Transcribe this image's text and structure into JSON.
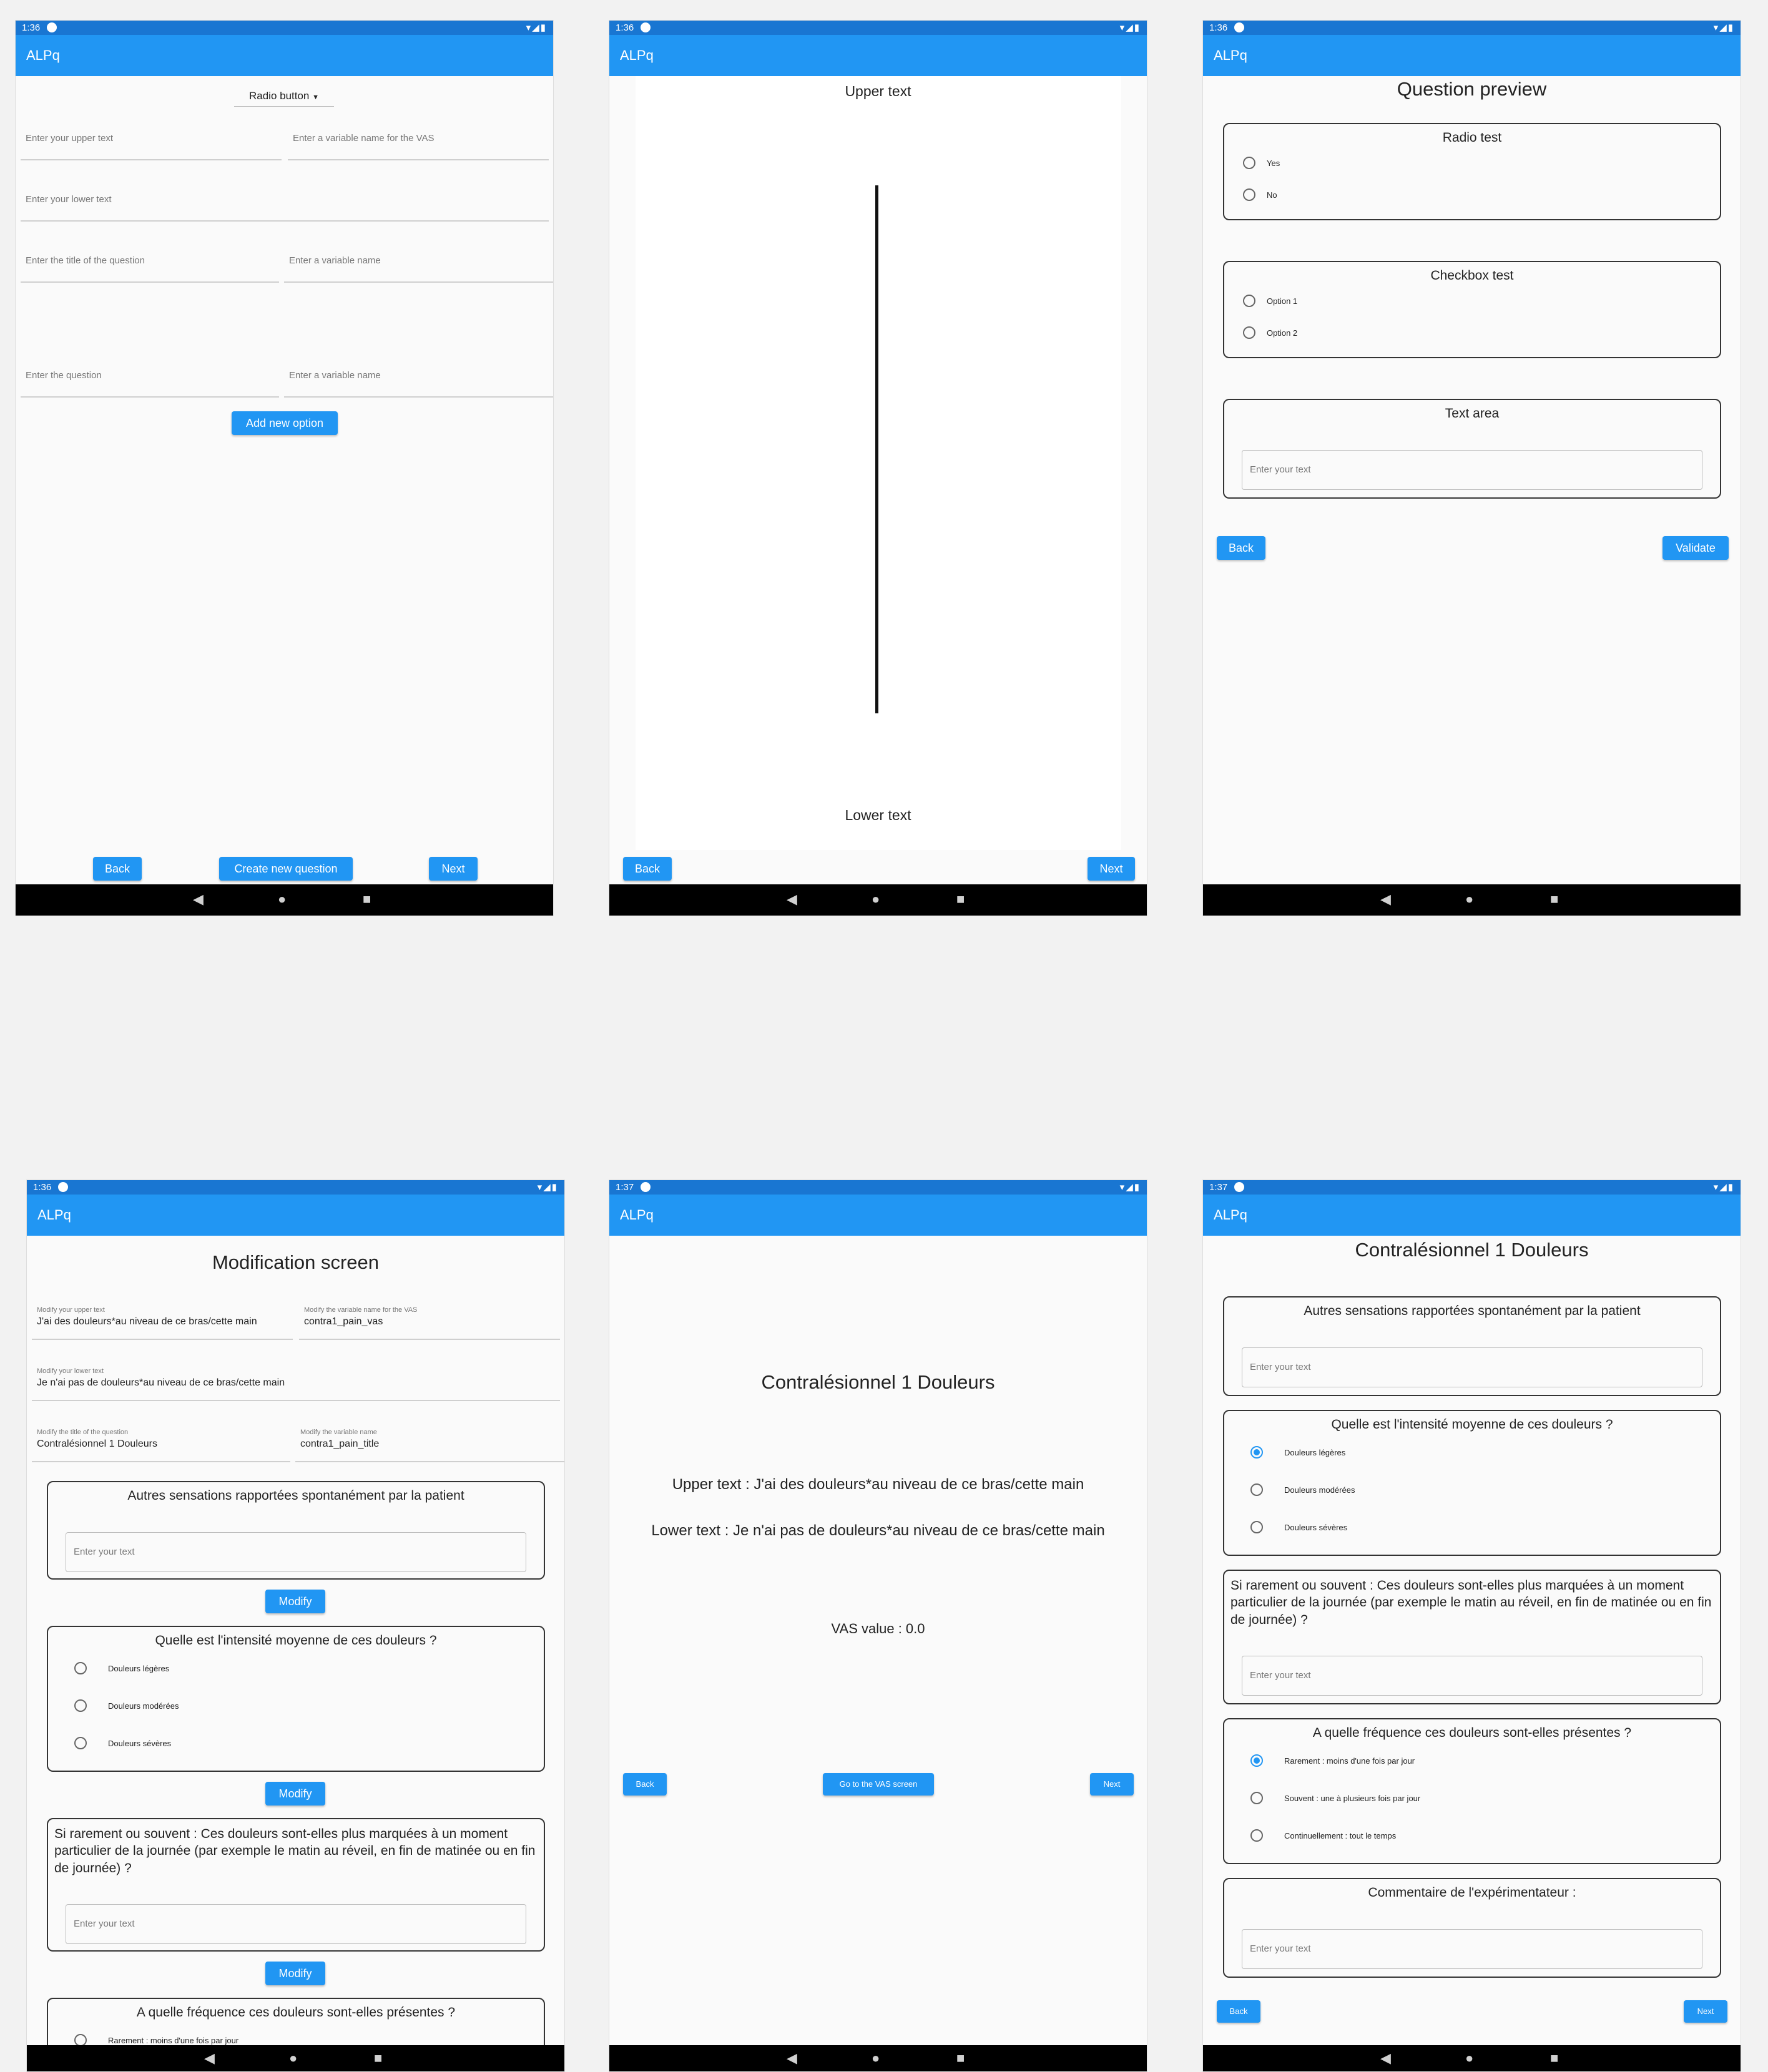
{
  "app_name": "ALPq",
  "status_icons": "▾◢▮",
  "nav": {
    "back": "◀",
    "home": "●",
    "recent": "■"
  },
  "s1": {
    "time": "1:36",
    "dropdown": "Radio button",
    "upper_ph": "Enter your upper text",
    "vas_var_ph": "Enter a variable name for the VAS",
    "lower_ph": "Enter your lower text",
    "title_ph": "Enter the title of the question",
    "var_ph": "Enter a variable name",
    "question_ph": "Enter the question",
    "var_ph2": "Enter a variable name",
    "add_option": "Add new option",
    "back": "Back",
    "create": "Create new question",
    "next": "Next"
  },
  "s2": {
    "time": "1:36",
    "upper": "Upper text",
    "lower": "Lower text",
    "back": "Back",
    "next": "Next"
  },
  "s3": {
    "time": "1:36",
    "title": "Question preview",
    "radio_title": "Radio test",
    "radio_opts": [
      "Yes",
      "No"
    ],
    "check_title": "Checkbox test",
    "check_opts": [
      "Option 1",
      "Option 2"
    ],
    "text_title": "Text area",
    "text_ph": "Enter your text",
    "back": "Back",
    "validate": "Validate"
  },
  "s4": {
    "time": "1:36",
    "title": "Modification screen",
    "f_upper_lbl": "Modify your upper text",
    "f_upper_val": "J'ai des douleurs*au niveau de ce bras/cette main",
    "f_vas_lbl": "Modify the variable name for the VAS",
    "f_vas_val": "contra1_pain_vas",
    "f_lower_lbl": "Modify your lower text",
    "f_lower_val": "Je n'ai pas de douleurs*au niveau de ce bras/cette main",
    "f_title_lbl": "Modify the title of the question",
    "f_title_val": "Contralésionnel 1 Douleurs",
    "f_var_lbl": "Modify the variable name",
    "f_var_val": "contra1_pain_title",
    "q1": "Autres sensations rapportées spontanément par la patient",
    "text_ph": "Enter your text",
    "modify": "Modify",
    "q2": "Quelle est l'intensité moyenne de ces douleurs ?",
    "q2_opts": [
      "Douleurs légères",
      "Douleurs modérées",
      "Douleurs sévères"
    ],
    "q3": "Si rarement ou souvent : Ces douleurs sont-elles plus marquées à un moment particulier de la journée (par exemple le matin au réveil, en fin de matinée ou en fin de journée) ?",
    "q4": "A quelle fréquence ces douleurs sont-elles présentes ?",
    "q4_first": "Rarement : moins d'une fois par jour"
  },
  "s5": {
    "time": "1:37",
    "title": "Contralésionnel 1 Douleurs",
    "upper": "Upper text : J'ai des douleurs*au niveau de ce bras/cette main",
    "lower": "Lower text : Je n'ai pas de douleurs*au niveau de ce bras/cette main",
    "vas": "VAS value : 0.0",
    "back": "Back",
    "go": "Go to the VAS screen",
    "next": "Next"
  },
  "s6": {
    "time": "1:37",
    "title": "Contralésionnel 1 Douleurs",
    "q1": "Autres sensations rapportées spontanément par la patient",
    "text_ph": "Enter your text",
    "q2": "Quelle est l'intensité moyenne de ces douleurs ?",
    "q2_opts": [
      "Douleurs légères",
      "Douleurs modérées",
      "Douleurs sévères"
    ],
    "q3": "Si rarement ou souvent : Ces douleurs sont-elles plus marquées à un moment particulier de la journée (par exemple le matin au réveil, en fin de matinée ou en fin de journée) ?",
    "q4": "A quelle fréquence ces douleurs sont-elles présentes ?",
    "q4_opts": [
      "Rarement : moins d'une fois par jour",
      "Souvent : une à plusieurs fois par jour",
      "Continuellement : tout le temps"
    ],
    "q5": "Commentaire de l'expérimentateur :",
    "back": "Back",
    "next": "Next"
  }
}
